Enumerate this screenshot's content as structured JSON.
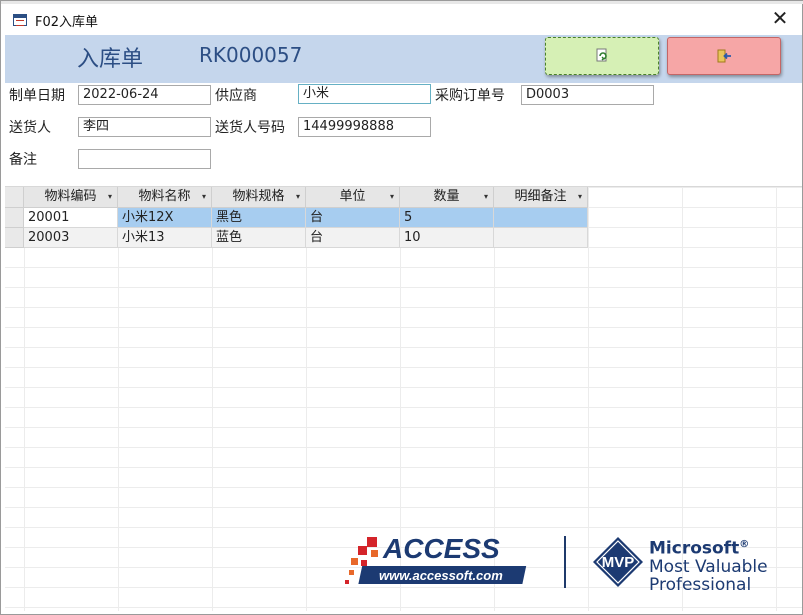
{
  "window": {
    "title": "F02入库单",
    "close_symbol": "✕"
  },
  "header": {
    "form_title": "入库单",
    "doc_number": "RK000057",
    "refresh_icon": "refresh-doc-icon",
    "exit_icon": "exit-door-icon",
    "refresh_color": "#d6f0b5",
    "exit_color": "#f6a6a6"
  },
  "fields": {
    "date": {
      "label": "制单日期",
      "value": "2022-06-24"
    },
    "supplier": {
      "label": "供应商",
      "value": "小米"
    },
    "po_number": {
      "label": "采购订单号",
      "value": "D0003"
    },
    "deliverer": {
      "label": "送货人",
      "value": "李四"
    },
    "deliverer_phone": {
      "label": "送货人号码",
      "value": "14499998888"
    },
    "remark": {
      "label": "备注",
      "value": ""
    }
  },
  "table": {
    "columns": [
      "物料编码",
      "物料名称",
      "物料规格",
      "单位",
      "数量",
      "明细备注"
    ],
    "column_arrows": [
      "▾",
      "▾",
      "▾",
      "▾",
      "▾",
      "▾"
    ],
    "rows": [
      [
        "20001",
        "小米12X",
        "黑色",
        "台",
        "5",
        ""
      ],
      [
        "20003",
        "小米13",
        "蓝色",
        "台",
        "10",
        ""
      ]
    ]
  },
  "branding": {
    "access_title": "ACCESS",
    "access_url": "www.accessoft.com",
    "mvp_badge": "MVP",
    "mvp_line1": "Microsoft",
    "mvp_reg": "®",
    "mvp_line2": "Most Valuable",
    "mvp_line3": "Professional"
  },
  "colors": {
    "header_band": "#c5d6ec",
    "title_text": "#2c4e84",
    "selected_row": "#a7cdf0",
    "brand_navy": "#1c3a72",
    "brand_red": "#d4242a"
  }
}
